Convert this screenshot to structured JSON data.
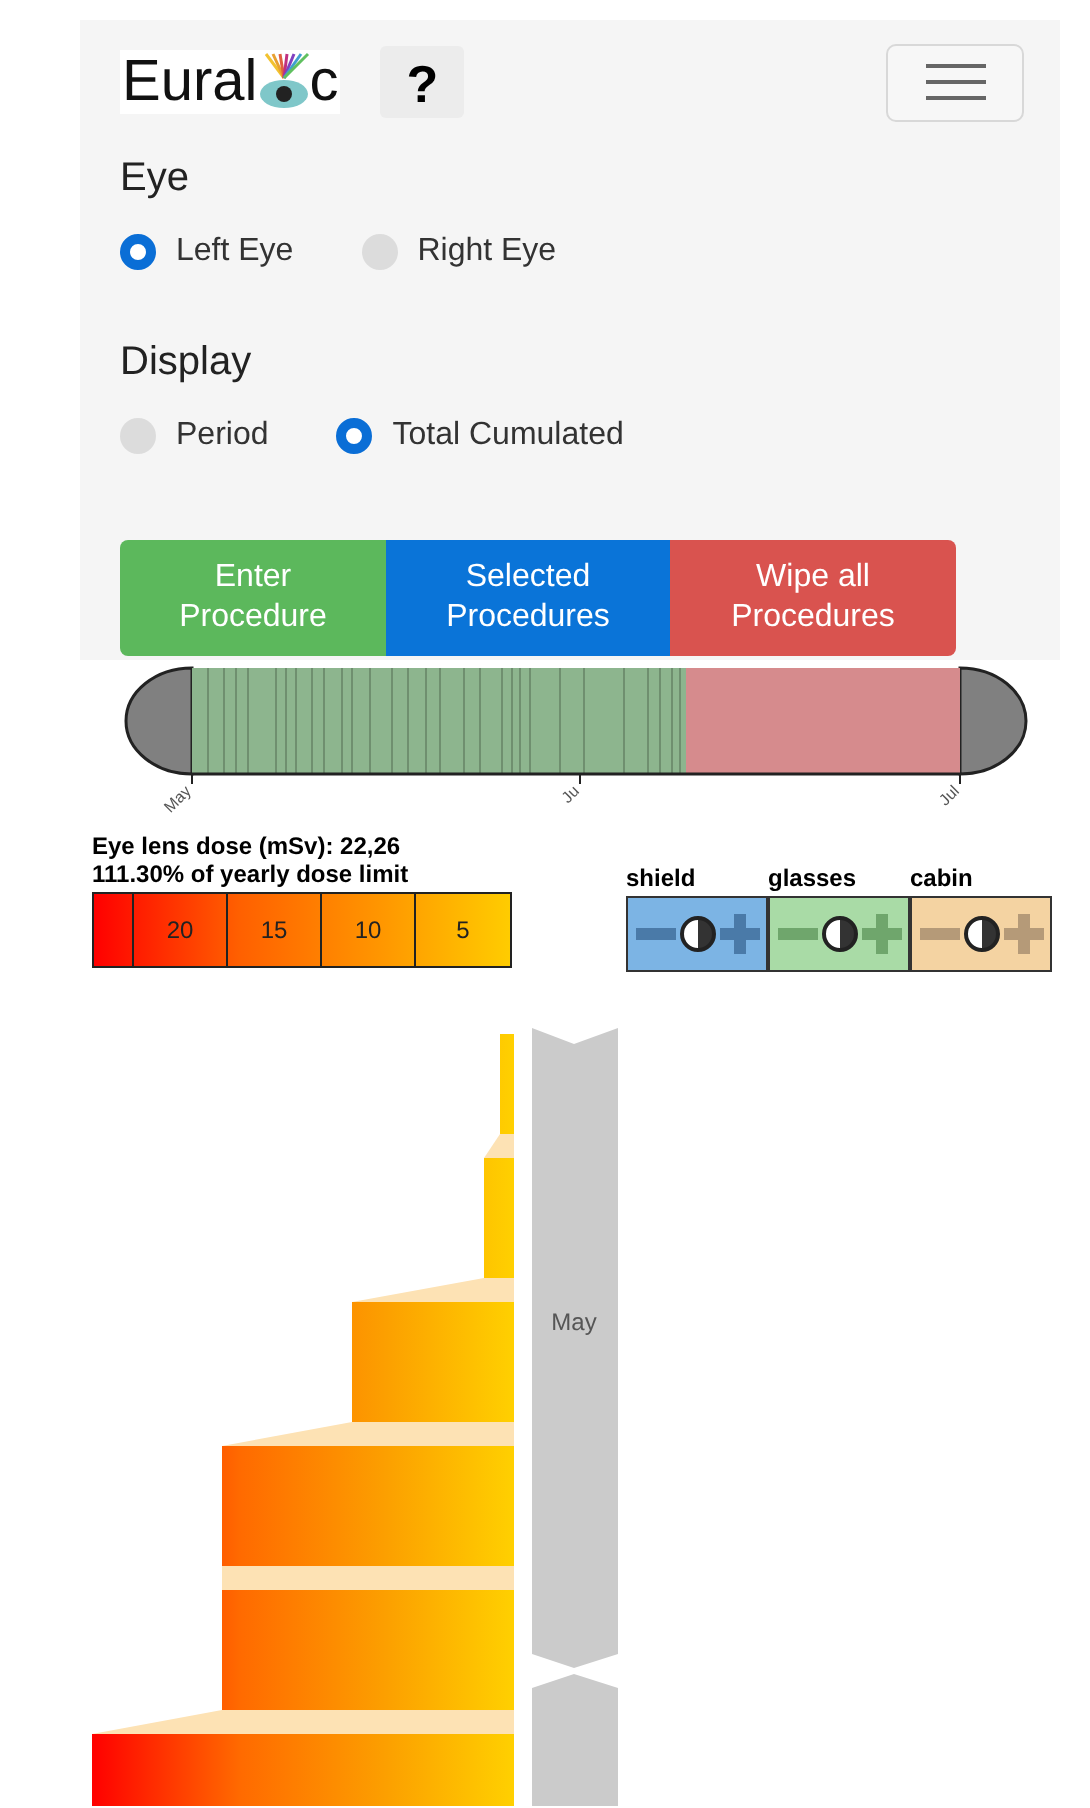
{
  "header": {
    "logo": [
      "Eural",
      "c"
    ],
    "help": "?"
  },
  "eye": {
    "title": "Eye",
    "options": [
      {
        "label": "Left Eye",
        "selected": true
      },
      {
        "label": "Right Eye",
        "selected": false
      }
    ]
  },
  "display": {
    "title": "Display",
    "options": [
      {
        "label": "Period",
        "selected": false
      },
      {
        "label": "Total Cumulated",
        "selected": true
      }
    ]
  },
  "buttons": [
    {
      "label": "Enter Procedure",
      "kind": "enter"
    },
    {
      "label": "Selected Procedures",
      "kind": "selected"
    },
    {
      "label": "Wipe all Procedures",
      "kind": "wipe"
    }
  ],
  "timeline": {
    "ticks": [
      "May",
      "Ju",
      "Jul"
    ]
  },
  "dose": {
    "summary": "Eye lens dose (mSv): 22,26",
    "limit": "111.30% of yearly dose limit",
    "scale": [
      "20",
      "15",
      "10",
      "5"
    ]
  },
  "protection": [
    {
      "label": "shield",
      "color": "#7cb4e4"
    },
    {
      "label": "glasses",
      "color": "#a9dba6"
    },
    {
      "label": "cabin",
      "color": "#f4d3a2"
    }
  ],
  "chart": {
    "month": "May"
  }
}
